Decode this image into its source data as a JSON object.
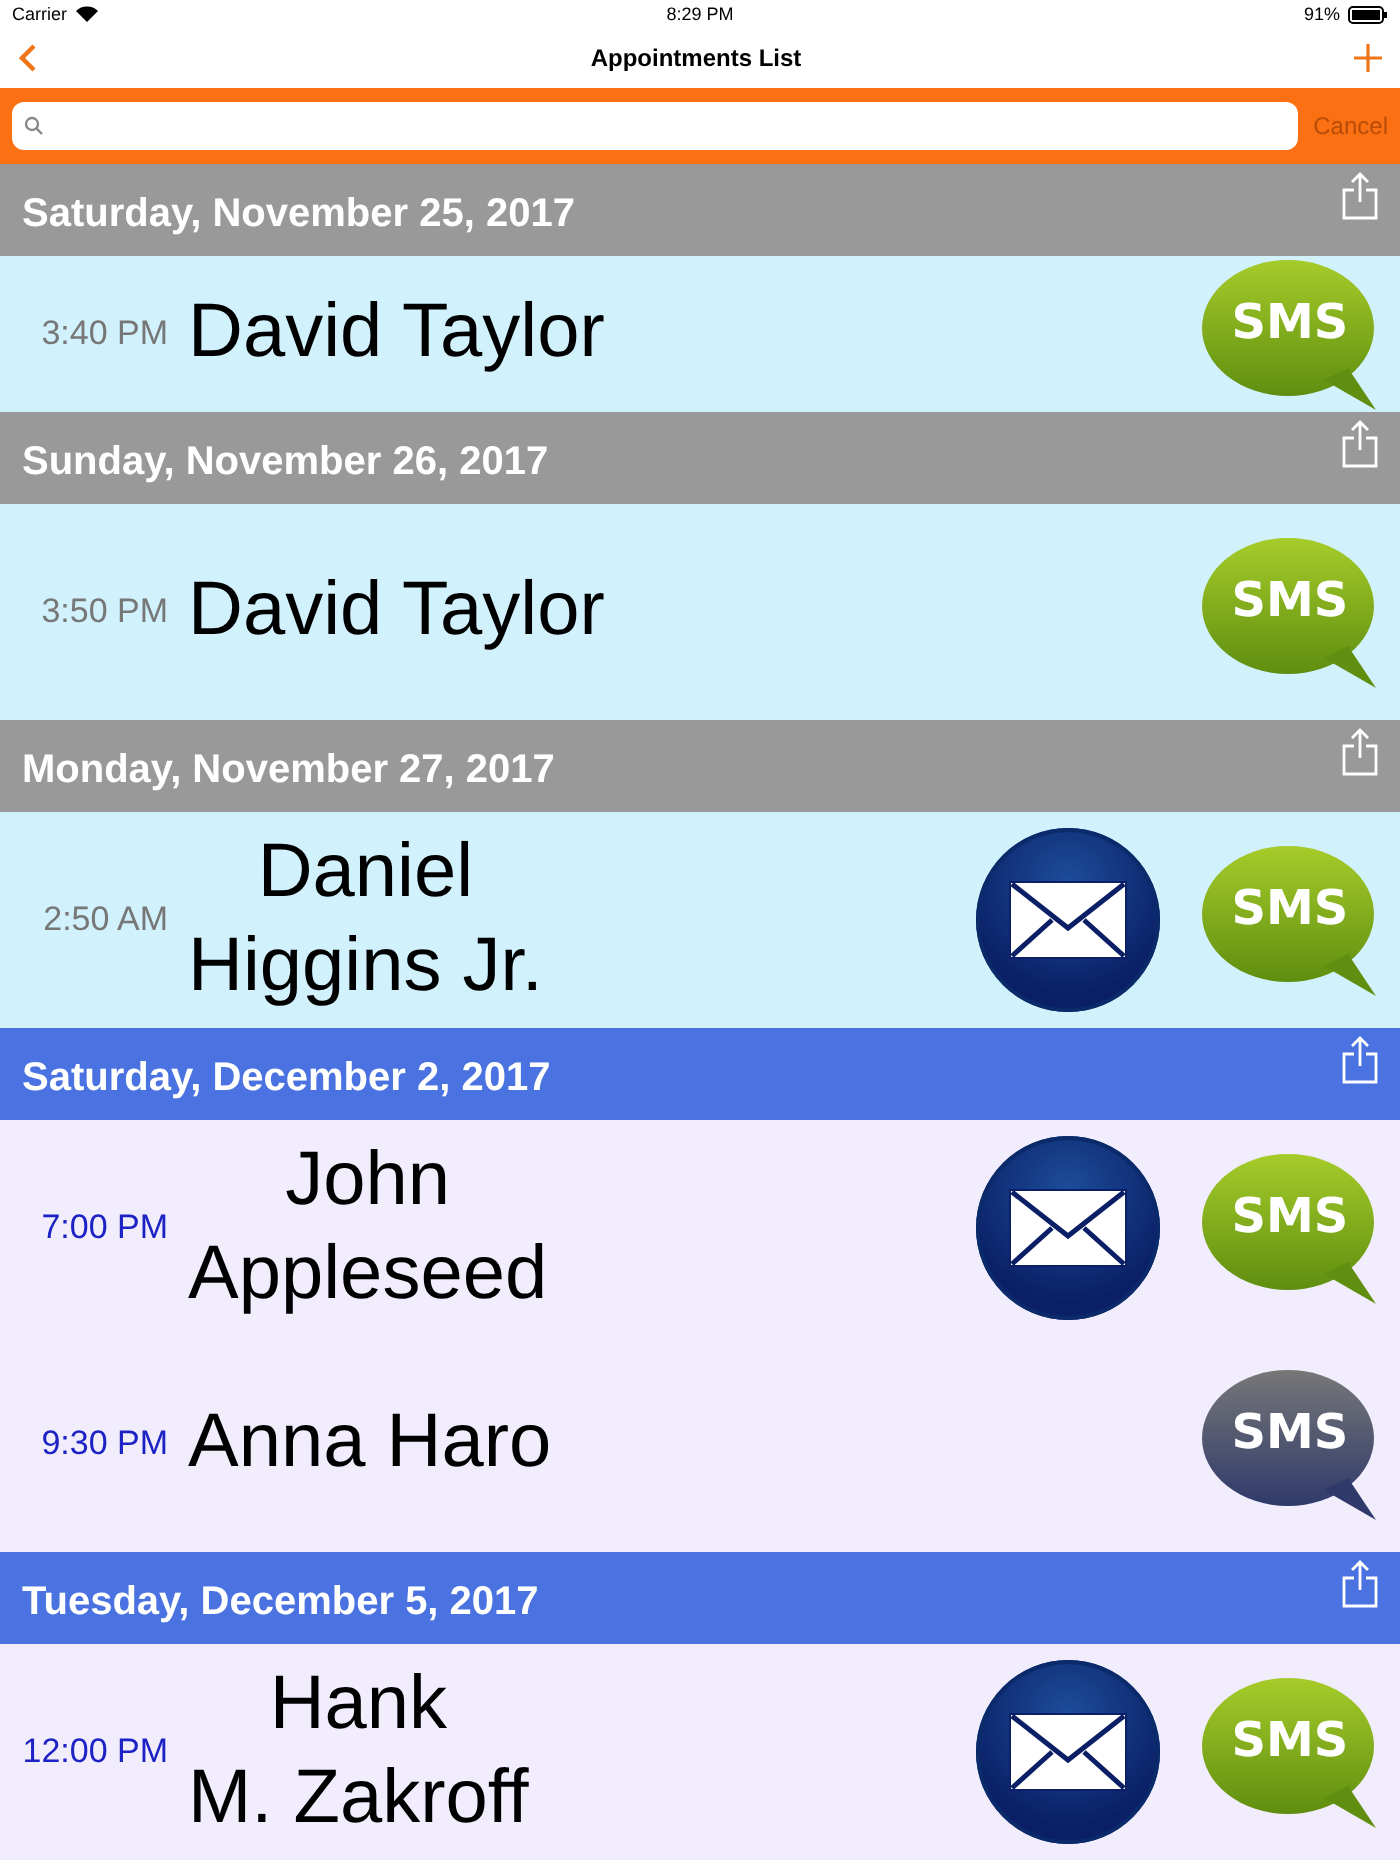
{
  "status_bar": {
    "carrier": "Carrier",
    "time": "8:29 PM",
    "battery": "91%"
  },
  "nav": {
    "title": "Appointments List"
  },
  "search": {
    "cancel": "Cancel"
  },
  "sections": [
    {
      "date": "Saturday, November 25, 2017",
      "past": true,
      "rows": [
        {
          "time": "3:40 PM",
          "name": "David Taylor",
          "has_email": false,
          "sms_label": "SMS",
          "sms_enabled": true
        }
      ]
    },
    {
      "date": "Sunday, November 26, 2017",
      "past": true,
      "rows": [
        {
          "time": "3:50 PM",
          "name": "David Taylor",
          "has_email": false,
          "sms_label": "SMS",
          "sms_enabled": true
        }
      ]
    },
    {
      "date": "Monday, November 27, 2017",
      "past": true,
      "rows": [
        {
          "time": "2:50 AM",
          "name": "Daniel\nHiggins Jr.",
          "has_email": true,
          "sms_label": "SMS",
          "sms_enabled": true
        }
      ]
    },
    {
      "date": "Saturday, December 2, 2017",
      "past": false,
      "rows": [
        {
          "time": "7:00 PM",
          "name": "John\nAppleseed",
          "has_email": true,
          "sms_label": "SMS",
          "sms_enabled": true
        },
        {
          "time": "9:30 PM",
          "name": "Anna Haro",
          "has_email": false,
          "sms_label": "SMS",
          "sms_enabled": false
        }
      ]
    },
    {
      "date": "Tuesday, December 5, 2017",
      "past": false,
      "rows": [
        {
          "time": "12:00 PM",
          "name": "Hank\nM. Zakroff",
          "has_email": true,
          "sms_label": "SMS",
          "sms_enabled": true
        }
      ]
    }
  ]
}
